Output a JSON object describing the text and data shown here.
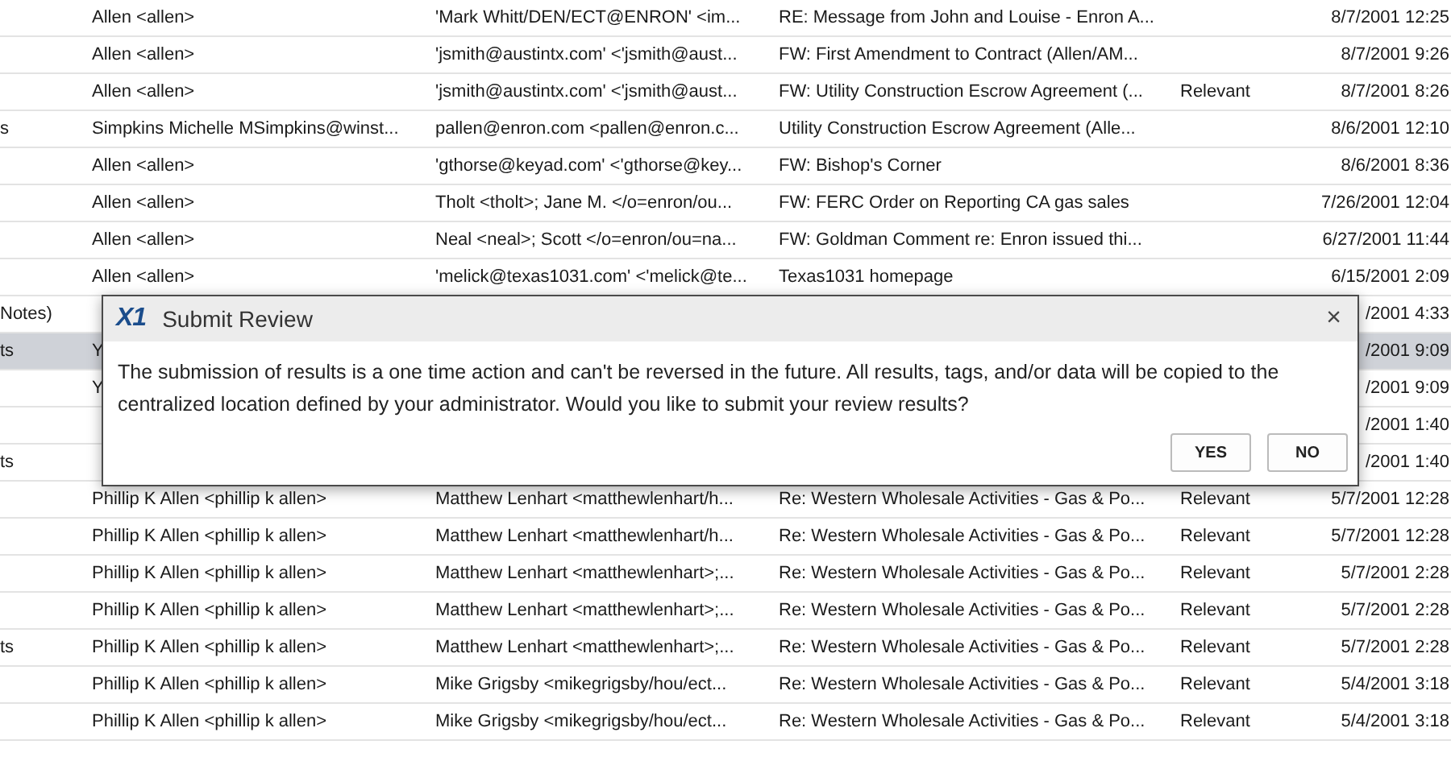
{
  "table": {
    "rows": [
      {
        "selected": false,
        "column_2": "Allen <allen>",
        "column_3": "'Mark Whitt/DEN/ECT@ENRON' <im...",
        "column_4": "RE: Message from John and Louise - Enron A...",
        "column_6": "8/7/2001 12:25"
      },
      {
        "selected": false,
        "column_2": "Allen <allen>",
        "column_3": "'jsmith@austintx.com' <'jsmith@aust...",
        "column_4": "FW: First Amendment to Contract (Allen/AM...",
        "column_6": "8/7/2001 9:26"
      },
      {
        "selected": false,
        "column_2": "Allen <allen>",
        "column_3": "'jsmith@austintx.com' <'jsmith@aust...",
        "column_4": "FW: Utility Construction Escrow Agreement (...",
        "column_5": "Relevant",
        "column_6": "8/7/2001 8:26"
      },
      {
        "selected": false,
        "column_1": "s",
        "column_2": "Simpkins  Michelle MSimpkins@winst...",
        "column_3": "pallen@enron.com <pallen@enron.c...",
        "column_4": "Utility Construction Escrow Agreement (Alle...",
        "column_6": "8/6/2001 12:10"
      },
      {
        "selected": false,
        "column_2": "Allen <allen>",
        "column_3": "'gthorse@keyad.com' <'gthorse@key...",
        "column_4": "FW: Bishop's Corner",
        "column_6": "8/6/2001 8:36"
      },
      {
        "selected": false,
        "column_2": "Allen <allen>",
        "column_3": "Tholt <tholt>; Jane M. </o=enron/ou...",
        "column_4": "FW: FERC Order on Reporting CA gas sales",
        "column_6": "7/26/2001 12:04"
      },
      {
        "selected": false,
        "column_2": "Allen <allen>",
        "column_3": "Neal <neal>; Scott </o=enron/ou=na...",
        "column_4": "FW: Goldman Comment re: Enron issued thi...",
        "column_6": "6/27/2001 11:44"
      },
      {
        "selected": false,
        "column_2": "Allen <allen>",
        "column_3": "'melick@texas1031.com' <'melick@te...",
        "column_4": "Texas1031 homepage",
        "column_6": "6/15/2001 2:09"
      },
      {
        "selected": false,
        "column_1": "Notes)",
        "column_6": "/2001 4:33"
      },
      {
        "selected": true,
        "column_1": "ts",
        "column_2": "Y",
        "column_6": "/2001 9:09"
      },
      {
        "selected": false,
        "column_2": "Y",
        "column_6": "/2001 9:09"
      },
      {
        "selected": false,
        "column_6": "/2001 1:40"
      },
      {
        "selected": false,
        "column_1": "ts",
        "column_6": "/2001 1:40"
      },
      {
        "selected": false,
        "column_2": "Phillip K Allen <phillip k allen>",
        "column_3": "Matthew Lenhart <matthewlenhart/h...",
        "column_4": "Re: Western Wholesale Activities - Gas & Po...",
        "column_5": "Relevant",
        "column_6": "5/7/2001 12:28"
      },
      {
        "selected": false,
        "column_2": "Phillip K Allen <phillip k allen>",
        "column_3": "Matthew Lenhart <matthewlenhart/h...",
        "column_4": "Re: Western Wholesale Activities - Gas & Po...",
        "column_5": "Relevant",
        "column_6": "5/7/2001 12:28"
      },
      {
        "selected": false,
        "column_2": "Phillip K Allen <phillip k allen>",
        "column_3": "Matthew Lenhart <matthewlenhart>;...",
        "column_4": "Re: Western Wholesale Activities - Gas & Po...",
        "column_5": "Relevant",
        "column_6": "5/7/2001 2:28"
      },
      {
        "selected": false,
        "column_2": "Phillip K Allen <phillip k allen>",
        "column_3": "Matthew Lenhart <matthewlenhart>;...",
        "column_4": "Re: Western Wholesale Activities - Gas & Po...",
        "column_5": "Relevant",
        "column_6": "5/7/2001 2:28"
      },
      {
        "selected": false,
        "column_1": "ts",
        "column_2": "Phillip K Allen <phillip k allen>",
        "column_3": "Matthew Lenhart <matthewlenhart>;...",
        "column_4": "Re: Western Wholesale Activities - Gas & Po...",
        "column_5": "Relevant",
        "column_6": "5/7/2001 2:28"
      },
      {
        "selected": false,
        "column_2": "Phillip K Allen <phillip k allen>",
        "column_3": "Mike Grigsby <mikegrigsby/hou/ect...",
        "column_4": "Re: Western Wholesale Activities - Gas & Po...",
        "column_5": "Relevant",
        "column_6": "5/4/2001 3:18"
      },
      {
        "selected": false,
        "column_2": "Phillip K Allen <phillip k allen>",
        "column_3": "Mike Grigsby <mikegrigsby/hou/ect...",
        "column_4": "Re: Western Wholesale Activities - Gas & Po...",
        "column_5": "Relevant",
        "column_6": "5/4/2001 3:18"
      }
    ]
  },
  "dialog": {
    "logo": "X1",
    "title": "Submit Review",
    "close": "×",
    "message": "The submission of results is a one time action and can't be reversed in the future. All results, tags, and/or data will be copied to the centralized location defined by your administrator. Would you like to submit your review results?",
    "buttons": [
      "YES",
      "NO"
    ]
  }
}
